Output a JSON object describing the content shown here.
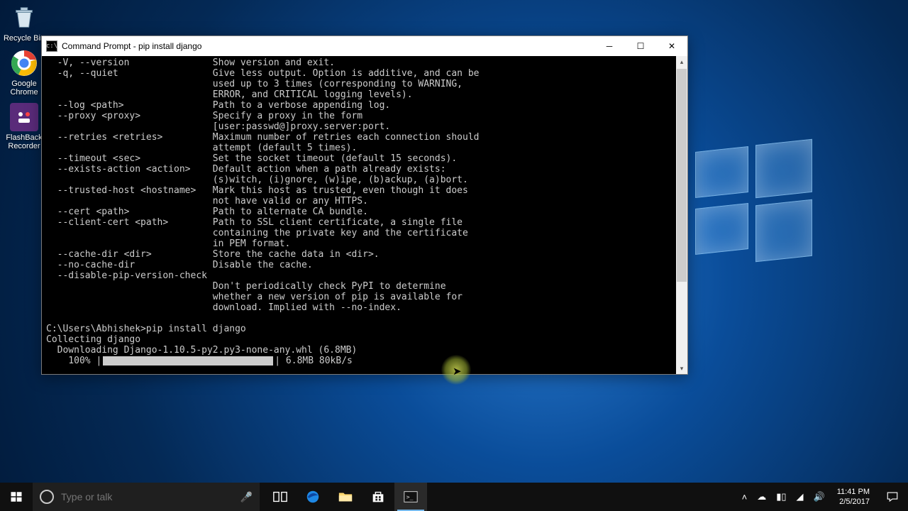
{
  "desktop": {
    "icons": [
      {
        "id": "recycle-bin",
        "label": "Recycle Bin"
      },
      {
        "id": "google-chrome",
        "label": "Google Chrome"
      },
      {
        "id": "flashback-recorder",
        "label": "FlashBack Recorder"
      }
    ]
  },
  "cmd": {
    "title": "Command Prompt - pip  install django",
    "lines": [
      "  -V, --version               Show version and exit.",
      "  -q, --quiet                 Give less output. Option is additive, and can be",
      "                              used up to 3 times (corresponding to WARNING,",
      "                              ERROR, and CRITICAL logging levels).",
      "  --log <path>                Path to a verbose appending log.",
      "  --proxy <proxy>             Specify a proxy in the form",
      "                              [user:passwd@]proxy.server:port.",
      "  --retries <retries>         Maximum number of retries each connection should",
      "                              attempt (default 5 times).",
      "  --timeout <sec>             Set the socket timeout (default 15 seconds).",
      "  --exists-action <action>    Default action when a path already exists:",
      "                              (s)witch, (i)gnore, (w)ipe, (b)ackup, (a)bort.",
      "  --trusted-host <hostname>   Mark this host as trusted, even though it does",
      "                              not have valid or any HTTPS.",
      "  --cert <path>               Path to alternate CA bundle.",
      "  --client-cert <path>        Path to SSL client certificate, a single file",
      "                              containing the private key and the certificate",
      "                              in PEM format.",
      "  --cache-dir <dir>           Store the cache data in <dir>.",
      "  --no-cache-dir              Disable the cache.",
      "  --disable-pip-version-check",
      "                              Don't periodically check PyPI to determine",
      "                              whether a new version of pip is available for",
      "                              download. Implied with --no-index.",
      ""
    ],
    "prompt_line": "C:\\Users\\Abhishek>pip install django",
    "collecting_line": "Collecting django",
    "downloading_line": "  Downloading Django-1.10.5-py2.py3-none-any.whl (6.8MB)",
    "progress_prefix": "    100% |",
    "progress_suffix": "| 6.8MB 80kB/s",
    "progress_percent": 100
  },
  "search": {
    "placeholder": "Type or talk"
  },
  "tray": {
    "time": "11:41 PM",
    "date": "2/5/2017"
  }
}
